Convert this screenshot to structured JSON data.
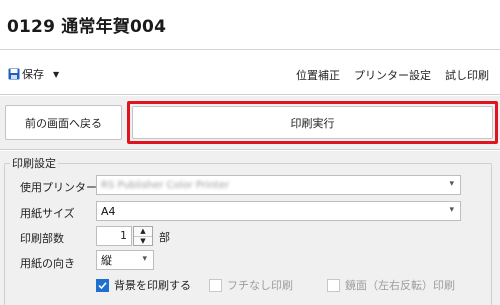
{
  "title": "0129 通常年賀004",
  "toolbar": {
    "save_label": "保存",
    "links": [
      "位置補正",
      "プリンター設定",
      "試し印刷"
    ]
  },
  "actions": {
    "back_label": "前の画面へ戻る",
    "print_label": "印刷実行"
  },
  "settings": {
    "group_label": "印刷設定",
    "printer_label": "使用プリンター",
    "printer_value": "RS Publisher Color Printer",
    "paper_size_label": "用紙サイズ",
    "paper_size_value": "A4",
    "copies_label": "印刷部数",
    "copies_value": "1",
    "copies_unit": "部",
    "orientation_label": "用紙の向き",
    "orientation_value": "縦",
    "checkboxes": [
      {
        "label": "背景を印刷する",
        "checked": true,
        "enabled": true
      },
      {
        "label": "フチなし印刷",
        "checked": false,
        "enabled": false
      },
      {
        "label": "鏡面（左右反転）印刷",
        "checked": false,
        "enabled": false
      }
    ]
  },
  "colors": {
    "highlight": "#e0141e",
    "checkbox_accent": "#1f6fd0",
    "save_icon": "#1f5fbf"
  }
}
